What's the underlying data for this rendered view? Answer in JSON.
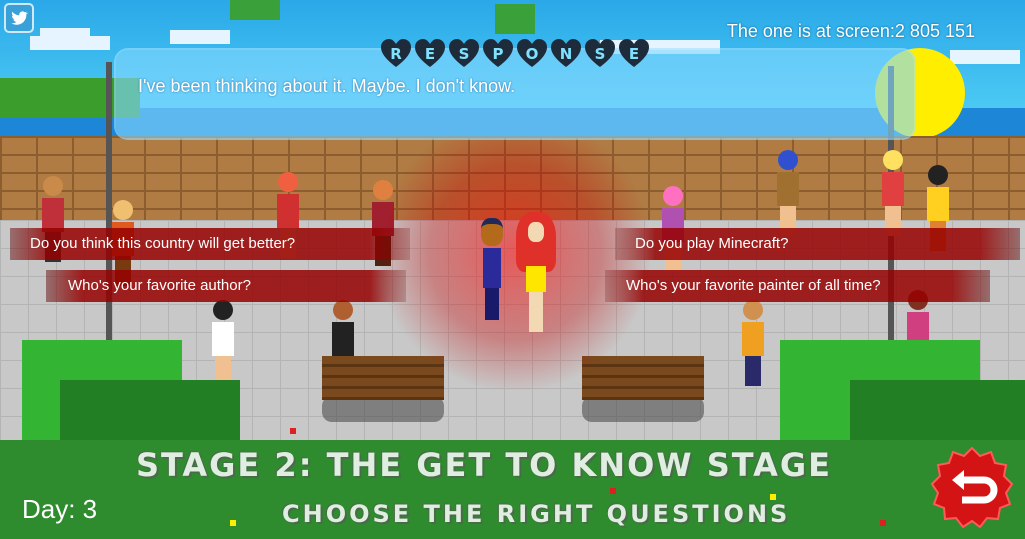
{
  "header": {
    "counter_text": "The one is at screen:2 805 151"
  },
  "response_panel": {
    "title_letters": [
      "R",
      "E",
      "S",
      "P",
      "O",
      "N",
      "S",
      "E"
    ],
    "text": "I've been thinking about it. Maybe. I don't know."
  },
  "questions": [
    "Do you think this country will get better?",
    "Do you play Minecraft?",
    "Who's your favorite author?",
    "Who's your favorite painter of all time?"
  ],
  "stage": {
    "title": "STAGE 2: THE GET TO KNOW STAGE",
    "subtitle": "CHOOSE THE RIGHT QUESTIONS"
  },
  "status": {
    "day_text": "Day: 3"
  },
  "icons": {
    "share": "twitter-bird-icon",
    "back": "return-arrow-icon"
  },
  "colors": {
    "question_bg": "#960000",
    "sky": "#39c0ef",
    "response_panel": "#82d7ff"
  }
}
